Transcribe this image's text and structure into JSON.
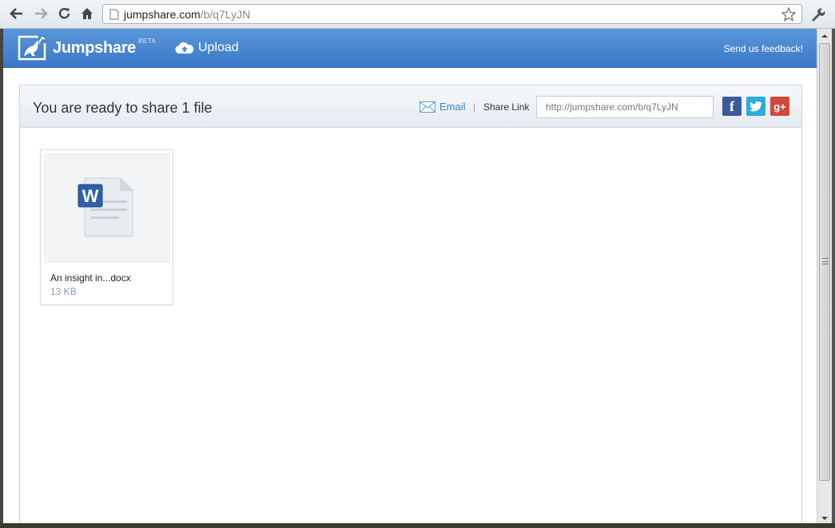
{
  "browser": {
    "url_host": "jumpshare.com",
    "url_path": "/b/q7LyJN"
  },
  "header": {
    "logo_text": "Jumpshare",
    "beta_label": "BETA",
    "upload_label": "Upload",
    "feedback_label": "Send us feedback!"
  },
  "share": {
    "title": "You are ready to share 1 file",
    "email_label": "Email",
    "separator": "|",
    "share_link_label": "Share Link",
    "share_link_value": "http://jumpshare.com/b/q7LyJN",
    "social": {
      "facebook": "f",
      "twitter": "t",
      "google": "g+"
    }
  },
  "files": [
    {
      "name": "An insight in...docx",
      "size": "13 KB",
      "icon": "word-document-icon"
    }
  ],
  "colors": {
    "header_blue": "#4a88d0",
    "link_blue": "#3a86d0",
    "facebook": "#3b5a9a",
    "twitter": "#2fa9e0",
    "google": "#d34836"
  }
}
